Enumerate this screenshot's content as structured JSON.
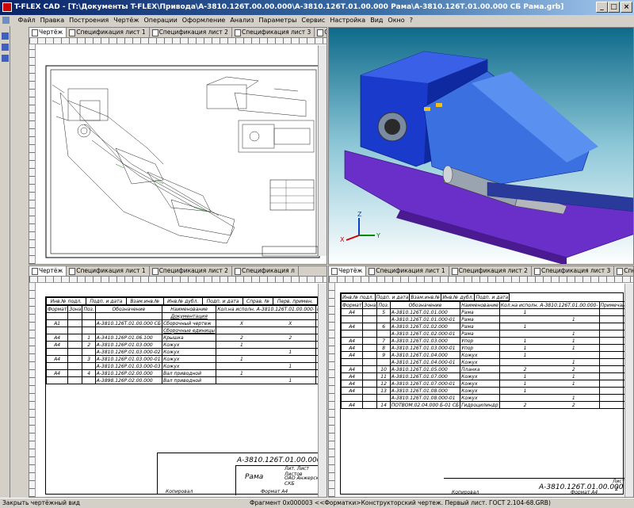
{
  "window": {
    "title": "T-FLEX CAD - [T:\\Документы T-FLEX\\Привода\\А-3810.126Т.00.00.000\\А-3810.126Т.01.00.000 Рама\\А-3810.126Т.01.00.000 СБ Рама.grb]"
  },
  "menu": [
    "Файл",
    "Правка",
    "Построения",
    "Чертёж",
    "Операции",
    "Оформление",
    "Анализ",
    "Параметры",
    "Сервис",
    "Настройка",
    "Вид",
    "Окно",
    "?"
  ],
  "top_left_tabs": [
    "Чертёж",
    "Спецификация лист 1",
    "Спецификация лист 2",
    "Спецификация лист 3",
    "Спец"
  ],
  "mid_left_tabs": [
    "Чертёж",
    "Спецификация лист 1",
    "Спецификация лист 2",
    "Спецификация л"
  ],
  "mid_right_tabs": [
    "Чертёж",
    "Спецификация лист 1",
    "Спецификация лист 2",
    "Спецификация лист 3",
    "Спец"
  ],
  "axes": {
    "x": "X",
    "y": "Y",
    "z": "Z"
  },
  "spec1": {
    "top_strip": [
      "Инв.№ подл.",
      "Подп. и дата",
      "Взам.инв.№",
      "Инв.№ дубл.",
      "Подп. и дата",
      "Справ. №",
      "Перв. примен."
    ],
    "headers": [
      "Формат",
      "Зона",
      "Поз.",
      "Обозначение",
      "Наименование",
      "Кол.на исполн. А-3810.126Т.01.00.000-",
      "Примечание"
    ],
    "sub": [
      "-",
      "01"
    ],
    "rows": [
      {
        "f": "",
        "z": "",
        "p": "",
        "d": "",
        "n": "Документация",
        "q1": "",
        "q2": "",
        "u": true
      },
      {
        "f": "А1",
        "z": "",
        "p": "",
        "d": "А-3810.126Т.01.00.000 СБ",
        "n": "Сборочный чертеж",
        "q1": "X",
        "q2": "X"
      },
      {
        "f": "",
        "z": "",
        "p": "",
        "d": "",
        "n": "Сборочные единицы",
        "q1": "",
        "q2": "",
        "u": true
      },
      {
        "f": "А4",
        "z": "",
        "p": "1",
        "d": "А-3410.126Р.01.06.100",
        "n": "Крышка",
        "q1": "2",
        "q2": "2"
      },
      {
        "f": "А4",
        "z": "",
        "p": "2",
        "d": "А-3810.126Р.01.03.000",
        "n": "Кожух",
        "q1": "1",
        "q2": ""
      },
      {
        "f": "",
        "z": "",
        "p": "",
        "d": "А-3810.126Р.01.03.000-02",
        "n": "Кожух",
        "q1": "",
        "q2": "1"
      },
      {
        "f": "А4",
        "z": "",
        "p": "3",
        "d": "А-3810.126Р.01.03.000-01",
        "n": "Кожух",
        "q1": "1",
        "q2": ""
      },
      {
        "f": "",
        "z": "",
        "p": "",
        "d": "А-3810.126Р.01.03.000-03",
        "n": "Кожух",
        "q1": "",
        "q2": "1"
      },
      {
        "f": "А4",
        "z": "",
        "p": "4",
        "d": "А-3810.126Р.02.00.000",
        "n": "Вал приводной",
        "q1": "1",
        "q2": ""
      },
      {
        "f": "",
        "z": "",
        "p": "",
        "d": "А-3898.126Р.02.00.000",
        "n": "Вал приводной",
        "q1": "",
        "q2": "1"
      }
    ],
    "stamp": {
      "code": "А-3810.126Т.01.00.000",
      "name": "Рама",
      "org": "ОАО Анжерские\nСКБ",
      "sheet": "Лит. Лист Листов",
      "copied": "Копировал",
      "format": "Формат А4"
    }
  },
  "spec2": {
    "top_strip": [
      "Инв.№ подл.",
      "Подп. и дата",
      "Взам.инв.№",
      "Инв.№ дубл.",
      "Подп. и дата"
    ],
    "headers": [
      "Формат",
      "Зона",
      "Поз.",
      "Обозначение",
      "Наименование",
      "Кол.на исполн. А-3810.126Т.01.00.000-",
      "Примечание"
    ],
    "sub": [
      "-",
      "01"
    ],
    "rows": [
      {
        "f": "А4",
        "z": "",
        "p": "5",
        "d": "А-3810.126Т.01.01.000",
        "n": "Рама",
        "q1": "1",
        "q2": ""
      },
      {
        "f": "",
        "z": "",
        "p": "",
        "d": "А-3810.126Т.01.01.000-01",
        "n": "Рама",
        "q1": "",
        "q2": "1"
      },
      {
        "f": "А4",
        "z": "",
        "p": "6",
        "d": "А-3810.126Т.01.02.000",
        "n": "Рама",
        "q1": "1",
        "q2": ""
      },
      {
        "f": "",
        "z": "",
        "p": "",
        "d": "А-3810.126Т.01.02.000-01",
        "n": "Рама",
        "q1": "",
        "q2": "1"
      },
      {
        "f": "А4",
        "z": "",
        "p": "7",
        "d": "А-3810.126Т.01.03.000",
        "n": "Упор",
        "q1": "1",
        "q2": "1"
      },
      {
        "f": "А4",
        "z": "",
        "p": "8",
        "d": "А-3810.126Т.01.03.000-01",
        "n": "Упор",
        "q1": "1",
        "q2": "1"
      },
      {
        "f": "А4",
        "z": "",
        "p": "9",
        "d": "А-3810.126Т.01.04.000",
        "n": "Кожух",
        "q1": "1",
        "q2": ""
      },
      {
        "f": "",
        "z": "",
        "p": "",
        "d": "А-3810.126Т.01.04.000-01",
        "n": "Кожух",
        "q1": "",
        "q2": "1"
      },
      {
        "f": "А4",
        "z": "",
        "p": "10",
        "d": "А-3810.126Т.01.05.000",
        "n": "Планка",
        "q1": "2",
        "q2": "2"
      },
      {
        "f": "А4",
        "z": "",
        "p": "11",
        "d": "А-3810.126Т.01.07.000",
        "n": "Кожух",
        "q1": "1",
        "q2": "1"
      },
      {
        "f": "А4",
        "z": "",
        "p": "12",
        "d": "А-3810.126Т.01.07.000-01",
        "n": "Кожух",
        "q1": "1",
        "q2": "1"
      },
      {
        "f": "А4",
        "z": "",
        "p": "13",
        "d": "А-3810.126Т.01.08.000",
        "n": "Кожух",
        "q1": "1",
        "q2": ""
      },
      {
        "f": "",
        "z": "",
        "p": "",
        "d": "А-3810.126Т.01.08.000-01",
        "n": "Кожух",
        "q1": "",
        "q2": "1"
      },
      {
        "f": "А4",
        "z": "",
        "p": "14",
        "d": "ПОТВОМ.02.04.000 Б-01 СБ",
        "n": "Гидроцилиндр",
        "q1": "2",
        "q2": "2"
      }
    ],
    "stamp": {
      "code": "А-3810.126Т.01.00.000",
      "sheet": "Лист",
      "sheetnum": "2",
      "copied": "Копировал",
      "format": "Формат А4"
    }
  },
  "status": {
    "left": "Закрыть чертёжный вид",
    "mid": "Фрагмент 0x000003 <<Форматки>Конструкторский чертеж. Первый лист. ГОСТ 2.104-68.GRB)"
  }
}
